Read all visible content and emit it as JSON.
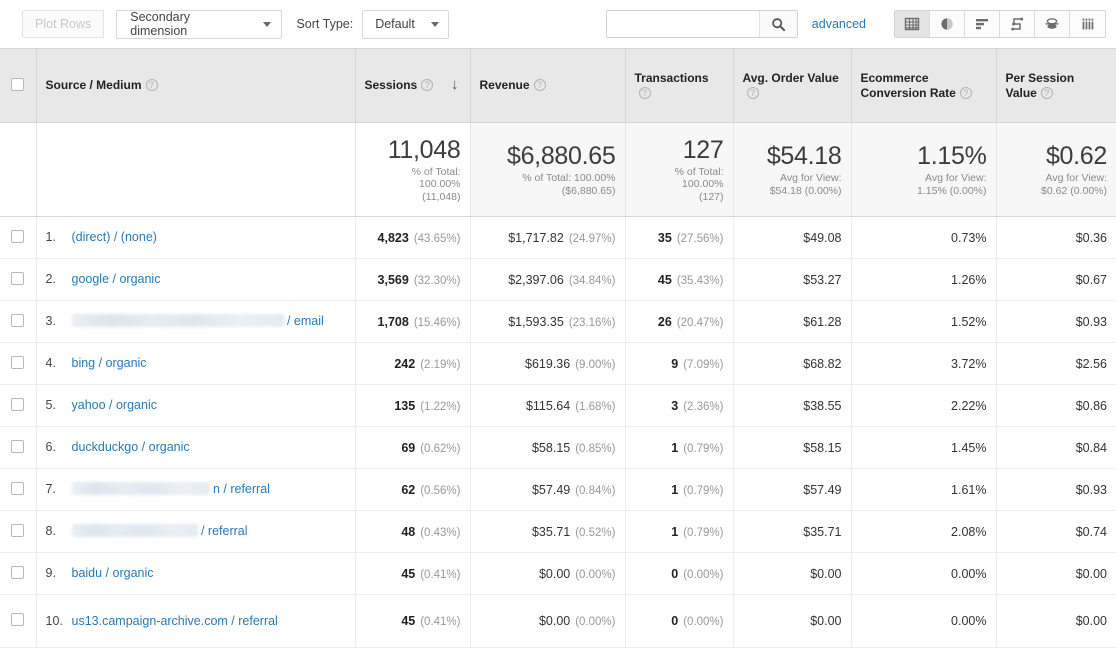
{
  "toolbar": {
    "plot_rows_label": "Plot Rows",
    "secondary_dimension_label": "Secondary dimension",
    "sort_type_label": "Sort Type:",
    "sort_type_value": "Default",
    "search_value": "",
    "search_placeholder": "",
    "advanced_label": "advanced",
    "view_icons": [
      {
        "name": "table-view-icon",
        "active": true
      },
      {
        "name": "pie-chart-view-icon",
        "active": false
      },
      {
        "name": "bar-chart-view-icon",
        "active": false
      },
      {
        "name": "performance-view-icon",
        "active": false
      },
      {
        "name": "comparison-view-icon",
        "active": false
      },
      {
        "name": "pivot-view-icon",
        "active": false
      }
    ]
  },
  "table": {
    "columns": [
      {
        "label": "Source / Medium",
        "help": "?"
      },
      {
        "label": "Sessions",
        "help": "?",
        "sorted": true,
        "sort_dir": "desc"
      },
      {
        "label": "Revenue",
        "help": "?"
      },
      {
        "label": "Transactions",
        "help": "?"
      },
      {
        "label": "Avg. Order Value",
        "help": "?"
      },
      {
        "label": "Ecommerce Conversion Rate",
        "help": "?"
      },
      {
        "label": "Per Session Value",
        "help": "?"
      }
    ],
    "summary": [
      {
        "value": "11,048",
        "lines": [
          "% of Total:",
          "100.00%",
          "(11,048)"
        ]
      },
      {
        "value": "$6,880.65",
        "lines": [
          "% of Total: 100.00%",
          "($6,880.65)"
        ]
      },
      {
        "value": "127",
        "lines": [
          "% of Total:",
          "100.00%",
          "(127)"
        ]
      },
      {
        "value": "$54.18",
        "lines": [
          "Avg for View:",
          "$54.18 (0.00%)"
        ]
      },
      {
        "value": "1.15%",
        "lines": [
          "Avg for View:",
          "1.15% (0.00%)"
        ]
      },
      {
        "value": "$0.62",
        "lines": [
          "Avg for View:",
          "$0.62 (0.00%)"
        ]
      }
    ],
    "rows": [
      {
        "index": "1.",
        "source": "(direct) / (none)",
        "redacted": false,
        "sessions": "4,823",
        "sessions_pct": "(43.65%)",
        "revenue": "$1,717.82",
        "revenue_pct": "(24.97%)",
        "transactions": "35",
        "transactions_pct": "(27.56%)",
        "aov": "$49.08",
        "ecr": "0.73%",
        "psv": "$0.36"
      },
      {
        "index": "2.",
        "source": "google / organic",
        "redacted": false,
        "sessions": "3,569",
        "sessions_pct": "(32.30%)",
        "revenue": "$2,397.06",
        "revenue_pct": "(34.84%)",
        "transactions": "45",
        "transactions_pct": "(35.43%)",
        "aov": "$53.27",
        "ecr": "1.26%",
        "psv": "$0.67"
      },
      {
        "index": "3.",
        "source": "/ email",
        "redacted": true,
        "redact_width": 212,
        "sessions": "1,708",
        "sessions_pct": "(15.46%)",
        "revenue": "$1,593.35",
        "revenue_pct": "(23.16%)",
        "transactions": "26",
        "transactions_pct": "(20.47%)",
        "aov": "$61.28",
        "ecr": "1.52%",
        "psv": "$0.93"
      },
      {
        "index": "4.",
        "source": "bing / organic",
        "redacted": false,
        "sessions": "242",
        "sessions_pct": "(2.19%)",
        "revenue": "$619.36",
        "revenue_pct": "(9.00%)",
        "transactions": "9",
        "transactions_pct": "(7.09%)",
        "aov": "$68.82",
        "ecr": "3.72%",
        "psv": "$2.56"
      },
      {
        "index": "5.",
        "source": "yahoo / organic",
        "redacted": false,
        "sessions": "135",
        "sessions_pct": "(1.22%)",
        "revenue": "$115.64",
        "revenue_pct": "(1.68%)",
        "transactions": "3",
        "transactions_pct": "(2.36%)",
        "aov": "$38.55",
        "ecr": "2.22%",
        "psv": "$0.86"
      },
      {
        "index": "6.",
        "source": "duckduckgo / organic",
        "redacted": false,
        "sessions": "69",
        "sessions_pct": "(0.62%)",
        "revenue": "$58.15",
        "revenue_pct": "(0.85%)",
        "transactions": "1",
        "transactions_pct": "(0.79%)",
        "aov": "$58.15",
        "ecr": "1.45%",
        "psv": "$0.84"
      },
      {
        "index": "7.",
        "source": "n / referral",
        "redacted": true,
        "redact_width": 138,
        "sessions": "62",
        "sessions_pct": "(0.56%)",
        "revenue": "$57.49",
        "revenue_pct": "(0.84%)",
        "transactions": "1",
        "transactions_pct": "(0.79%)",
        "aov": "$57.49",
        "ecr": "1.61%",
        "psv": "$0.93"
      },
      {
        "index": "8.",
        "source": "/ referral",
        "redacted": true,
        "redact_width": 126,
        "sessions": "48",
        "sessions_pct": "(0.43%)",
        "revenue": "$35.71",
        "revenue_pct": "(0.52%)",
        "transactions": "1",
        "transactions_pct": "(0.79%)",
        "aov": "$35.71",
        "ecr": "2.08%",
        "psv": "$0.74"
      },
      {
        "index": "9.",
        "source": "baidu / organic",
        "redacted": false,
        "sessions": "45",
        "sessions_pct": "(0.41%)",
        "revenue": "$0.00",
        "revenue_pct": "(0.00%)",
        "transactions": "0",
        "transactions_pct": "(0.00%)",
        "aov": "$0.00",
        "ecr": "0.00%",
        "psv": "$0.00"
      },
      {
        "index": "10.",
        "source": "us13.campaign-archive.com / referral",
        "redacted": false,
        "tall": true,
        "sessions": "45",
        "sessions_pct": "(0.41%)",
        "revenue": "$0.00",
        "revenue_pct": "(0.00%)",
        "transactions": "0",
        "transactions_pct": "(0.00%)",
        "aov": "$0.00",
        "ecr": "0.00%",
        "psv": "$0.00"
      }
    ]
  },
  "colors": {
    "link": "#287ab7",
    "header_bg": "#e8e8e8",
    "summary_bg": "#f7f7f7"
  }
}
